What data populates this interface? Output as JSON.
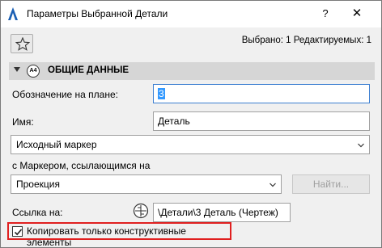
{
  "window": {
    "title": "Параметры Выбранной Детали",
    "help_label": "?",
    "close_label": "✕"
  },
  "toolbar": {
    "favorites_icon": "star-icon",
    "selected_info": "Выбрано: 1 Редактируемых: 1"
  },
  "section": {
    "title": "ОБЩИЕ ДАННЫЕ",
    "icon_text": "A4"
  },
  "fields": {
    "plan_id_label": "Обозначение на плане:",
    "plan_id_value": "3",
    "name_label": "Имя:",
    "name_value": "Деталь",
    "marker_select": "Исходный маркер",
    "ref_marker_label": "с Маркером, ссылающимся на",
    "ref_select": "Проекция",
    "find_button": "Найти...",
    "link_label": "Ссылка на:",
    "link_value": "\\Детали\\3 Деталь (Чертеж)"
  },
  "checkbox": {
    "label": "Копировать только конструктивные элементы",
    "checked": true
  },
  "colors": {
    "highlight_border": "#e01f1f",
    "focus_border": "#3c7fd1",
    "selection": "#3399ff"
  }
}
